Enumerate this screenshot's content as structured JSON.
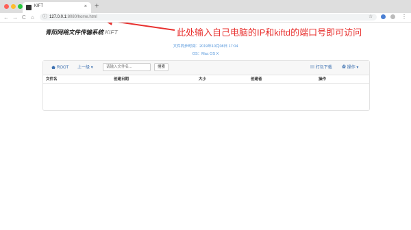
{
  "browser": {
    "tab_title": "KIFT",
    "new_tab": "+",
    "tab_close": "×",
    "url_host": "127.0.0.1",
    "url_rest": ":8080/home.html",
    "info_icon": "info-icon",
    "star_icon": "star-icon",
    "menu_icon": "kebab-menu-icon",
    "nav": {
      "back": "←",
      "forward": "→",
      "reload": "C",
      "home": "⌂"
    }
  },
  "header": {
    "brand_title": "青阳网络文件传输系统",
    "brand_sub": "KIFT"
  },
  "annotation": {
    "text": "此处输入自己电脑的IP和kiftd的端口号即可访问",
    "color": "#e8302e"
  },
  "status": {
    "sync_time": "文件同步时间：2019年10月08日 17:04",
    "os": "OS：Mac OS X"
  },
  "toolbar": {
    "root_label": "ROOT",
    "up_label": "上一级",
    "search_placeholder": "请输入文件名...",
    "search_button": "搜索",
    "pack_download": "打包下载",
    "operations": "操作"
  },
  "table": {
    "headers": [
      "文件名",
      "创建日期",
      "大小",
      "创建者",
      "操作"
    ]
  },
  "colors": {
    "accent": "#3a6fb0",
    "link_blue": "#4a90d9"
  }
}
